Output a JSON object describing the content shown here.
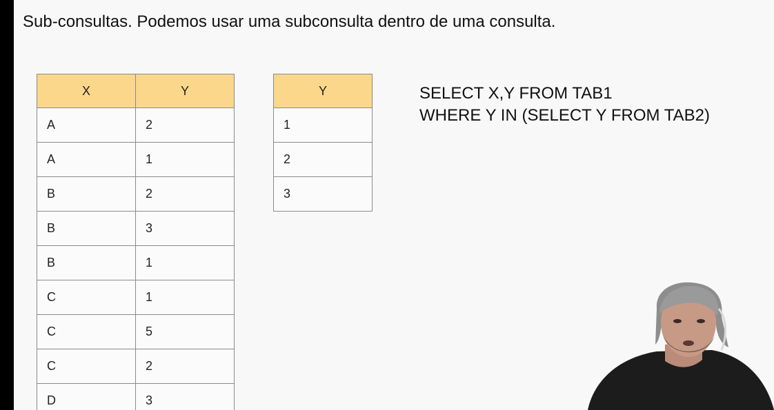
{
  "slide": {
    "title": "Sub-consultas. Podemos usar uma subconsulta dentro de uma consulta."
  },
  "tab1": {
    "headers": [
      "X",
      "Y"
    ],
    "rows": [
      [
        "A",
        "2"
      ],
      [
        "A",
        "1"
      ],
      [
        "B",
        "2"
      ],
      [
        "B",
        "3"
      ],
      [
        "B",
        "1"
      ],
      [
        "C",
        "1"
      ],
      [
        "C",
        "5"
      ],
      [
        "C",
        "2"
      ],
      [
        "D",
        "3"
      ]
    ]
  },
  "tab2": {
    "headers": [
      "Y"
    ],
    "rows": [
      [
        "1"
      ],
      [
        "2"
      ],
      [
        "3"
      ]
    ]
  },
  "sql": {
    "line1": "SELECT X,Y FROM TAB1",
    "line2": "WHERE Y IN (SELECT Y FROM TAB2)"
  },
  "colors": {
    "header_fill": "#fad78a",
    "border": "#8a8a8a",
    "slide_bg": "#f8f8f8",
    "frame": "#000000"
  }
}
